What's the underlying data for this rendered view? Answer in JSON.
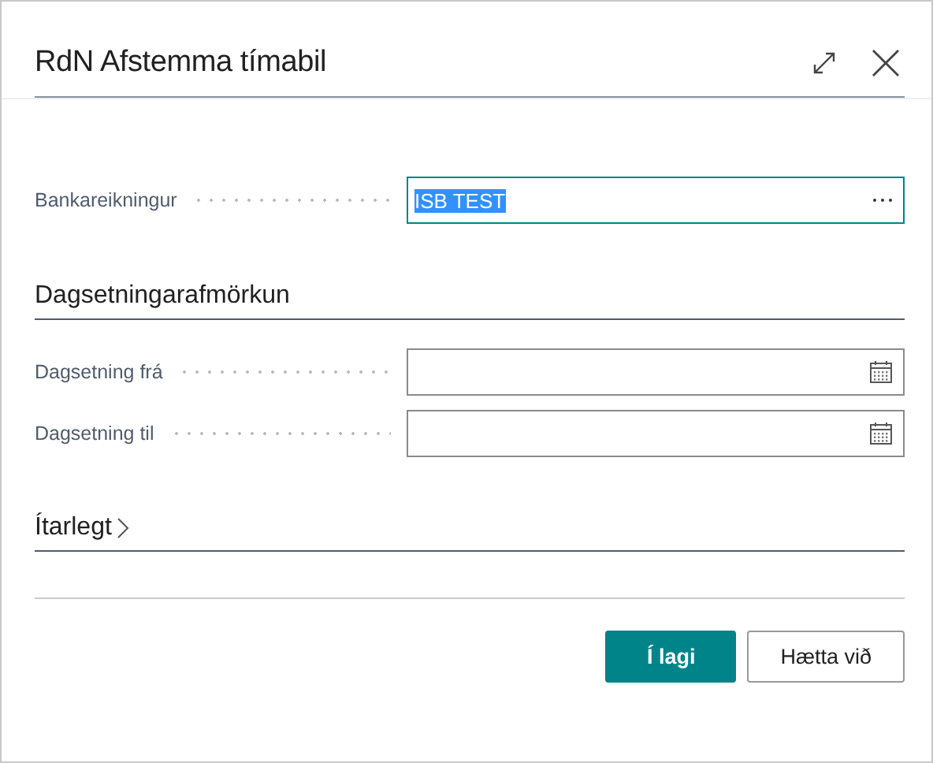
{
  "window": {
    "title": "RdN Afstemma tímabil"
  },
  "fields": [
    {
      "kind": "lookup",
      "label": "Bankareikningur",
      "value": "ISB TEST",
      "focused": true,
      "value_selected": true
    }
  ],
  "sections": [
    {
      "title": "Dagsetningarafmörkun",
      "fields": [
        {
          "kind": "date",
          "label": "Dagsetning frá",
          "focused": false
        },
        {
          "kind": "date",
          "label": "Dagsetning til",
          "focused": false
        }
      ]
    },
    {
      "title": "Ítarlegt",
      "expanded": false
    }
  ],
  "buttons": [
    {
      "label": "Í lagi",
      "primary": true
    },
    {
      "label": "Hætta við",
      "primary": false
    }
  ]
}
